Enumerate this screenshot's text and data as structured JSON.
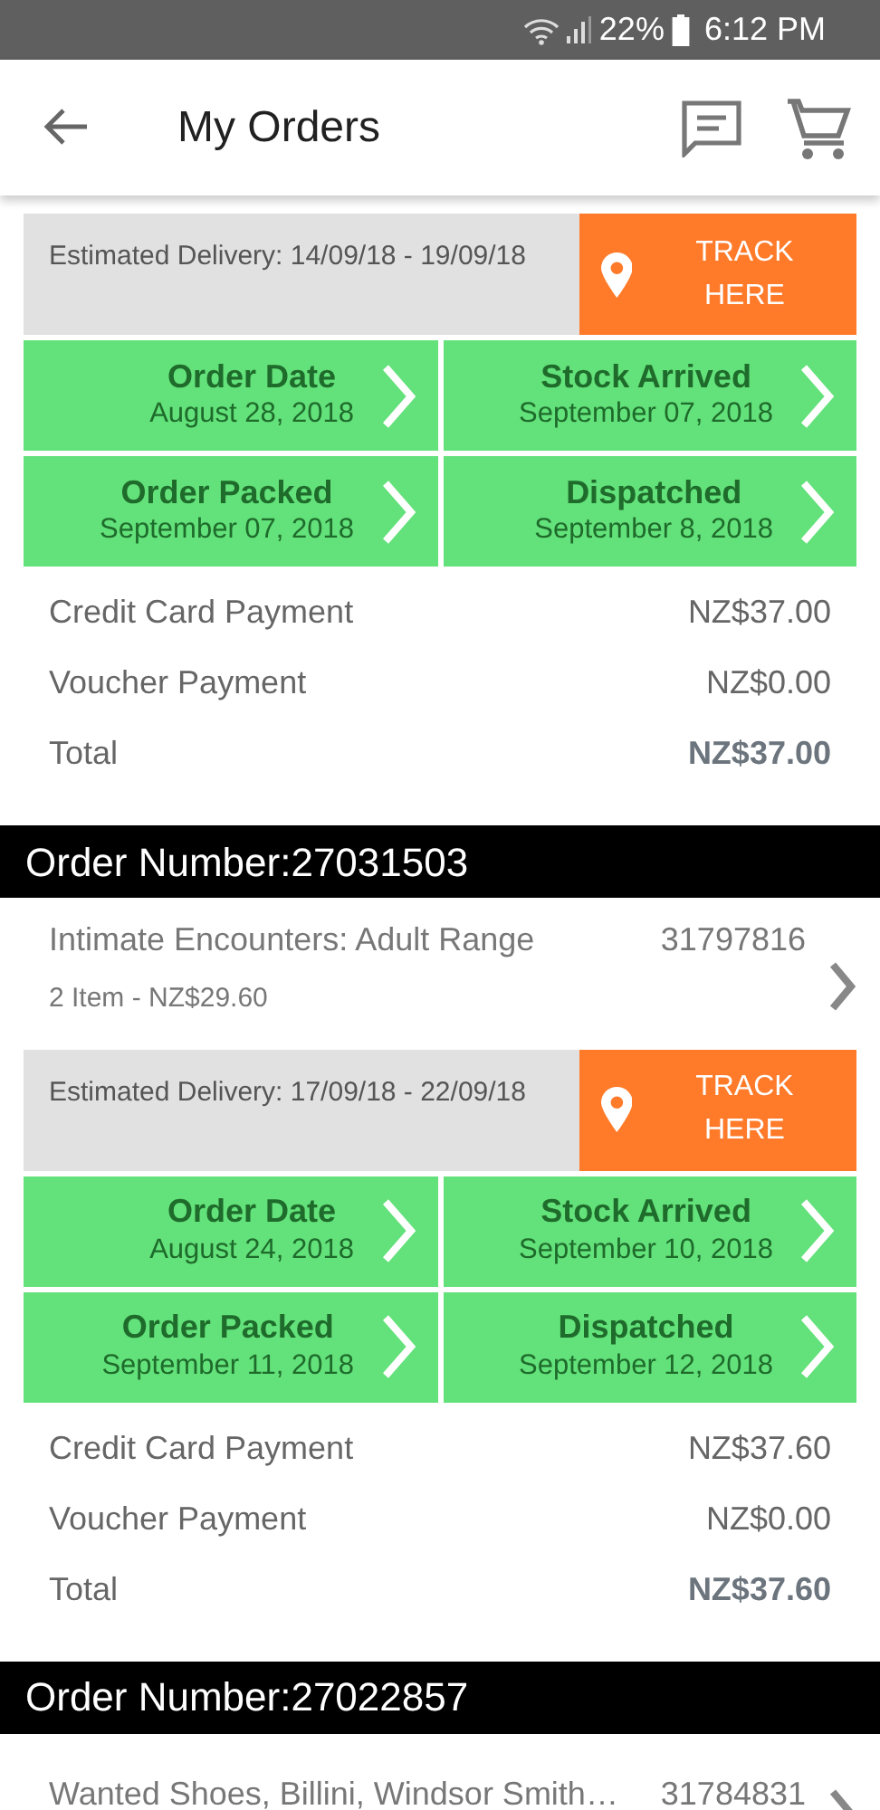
{
  "status_bar": {
    "battery": "22%",
    "time": "6:12 PM"
  },
  "app_bar": {
    "title": "My Orders"
  },
  "orders": [
    {
      "delivery": {
        "text": "Estimated Delivery: 14/09/18 - 19/09/18",
        "button": "TRACK HERE"
      },
      "stages": [
        {
          "label": "Order Date",
          "date": "August 28, 2018"
        },
        {
          "label": "Stock Arrived",
          "date": "September 07, 2018"
        },
        {
          "label": "Order Packed",
          "date": "September 07, 2018"
        },
        {
          "label": "Dispatched",
          "date": "September 8, 2018"
        }
      ],
      "payments": [
        {
          "label": "Credit Card Payment",
          "amount": "NZ$37.00",
          "kind": "line"
        },
        {
          "label": "Voucher Payment",
          "amount": "NZ$0.00",
          "kind": "line"
        },
        {
          "label": "Total",
          "amount": "NZ$37.00",
          "kind": "total"
        }
      ]
    },
    {
      "number": "Order Number:27031503",
      "item": {
        "name": "Intimate Encounters: Adult Range",
        "code": "31797816",
        "detail": "2 Item - NZ$29.60"
      },
      "delivery": {
        "text": "Estimated Delivery: 17/09/18 - 22/09/18",
        "button": "TRACK HERE"
      },
      "stages": [
        {
          "label": "Order Date",
          "date": "August 24, 2018"
        },
        {
          "label": "Stock Arrived",
          "date": "September 10, 2018"
        },
        {
          "label": "Order Packed",
          "date": "September 11, 2018"
        },
        {
          "label": "Dispatched",
          "date": "September 12, 2018"
        }
      ],
      "payments": [
        {
          "label": "Credit Card Payment",
          "amount": "NZ$37.60",
          "kind": "line"
        },
        {
          "label": "Voucher Payment",
          "amount": "NZ$0.00",
          "kind": "line"
        },
        {
          "label": "Total",
          "amount": "NZ$37.60",
          "kind": "total"
        }
      ]
    },
    {
      "number": "Order Number:27022857",
      "item": {
        "name": "Wanted Shoes, Billini, Windsor Smith…",
        "code": "31784831"
      }
    }
  ]
}
